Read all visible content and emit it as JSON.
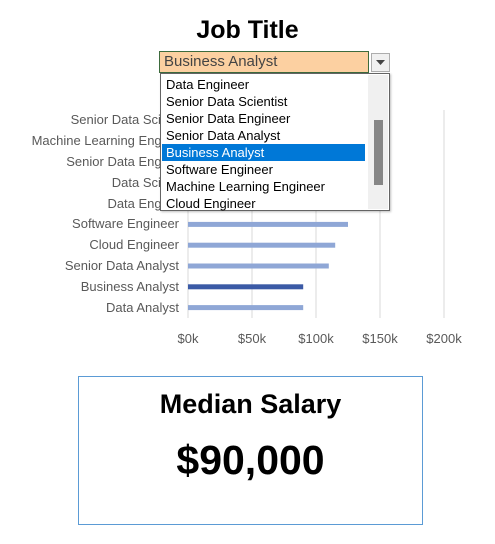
{
  "title": "Job Title",
  "dropdown": {
    "selected_value": "Business Analyst",
    "options": [
      "Data Engineer",
      "Senior Data Scientist",
      "Senior Data Engineer",
      "Senior Data Analyst",
      "Business Analyst",
      "Software Engineer",
      "Machine Learning Engineer",
      "Cloud Engineer"
    ],
    "selected_index": 4,
    "arrow_icon": "chevron-down-icon"
  },
  "chart_data": {
    "type": "bar",
    "orientation": "horizontal",
    "categories": [
      "Senior Data Scient",
      "Machine Learning Engine",
      "Senior Data Engine",
      "Data Scient",
      "Data Engine",
      "Software Engineer",
      "Cloud Engineer",
      "Senior Data Analyst",
      "Business Analyst",
      "Data Analyst"
    ],
    "values": [
      null,
      null,
      null,
      null,
      null,
      125000,
      115000,
      110000,
      90000,
      90000
    ],
    "highlight": "Business Analyst",
    "xticks": [
      "$0k",
      "$50k",
      "$100k",
      "$150k",
      "$200k"
    ],
    "xlim": [
      0,
      200000
    ],
    "grid": true,
    "colors": {
      "bar": "#8fa7d6",
      "highlight": "#3b5aa6",
      "grid": "#d9d9d9"
    }
  },
  "summary": {
    "label": "Median Salary",
    "value": "$90,000"
  }
}
